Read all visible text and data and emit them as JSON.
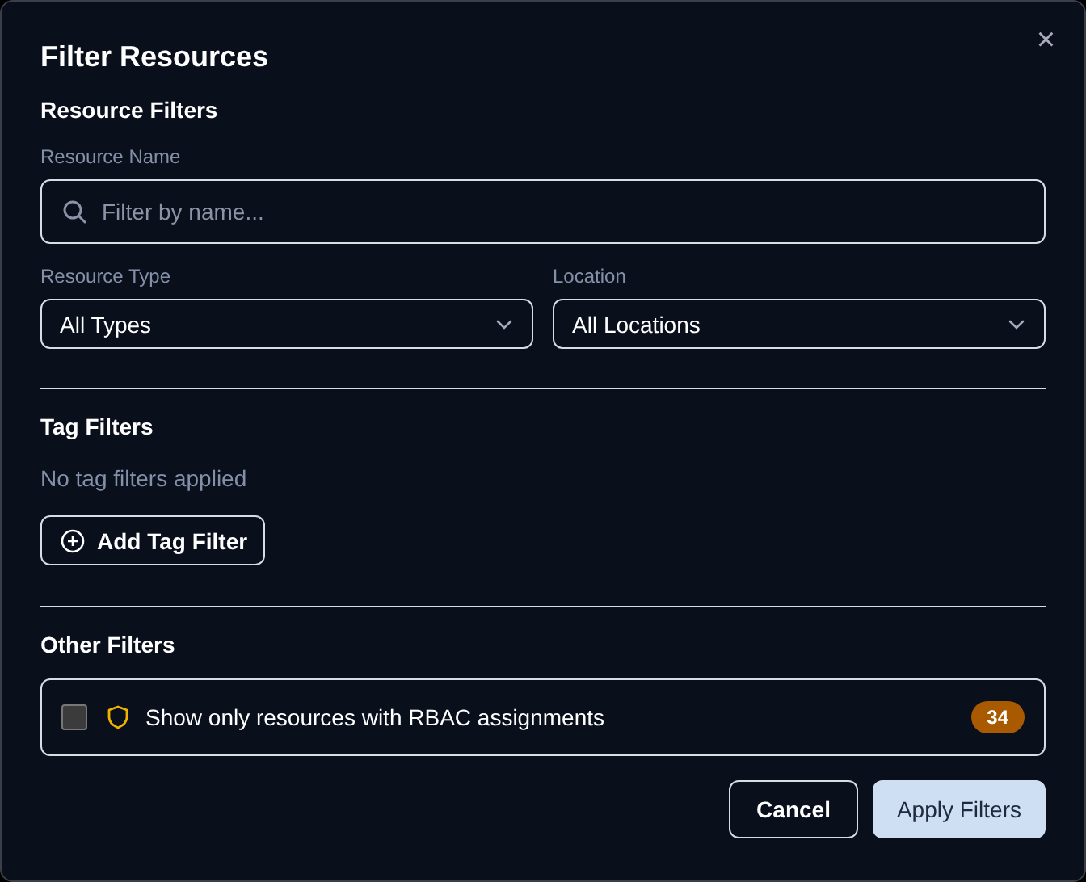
{
  "dialog": {
    "title": "Filter Resources",
    "close": "×"
  },
  "resource_filters": {
    "heading": "Resource Filters",
    "name_field": {
      "label": "Resource Name",
      "placeholder": "Filter by name..."
    },
    "selects": [
      {
        "label": "Resource Type",
        "value": "All Types"
      },
      {
        "label": "Location",
        "value": "All Locations"
      }
    ]
  },
  "tag_filters": {
    "heading": "Tag Filters",
    "empty_text": "No tag filters applied",
    "add_button": "Add Tag Filter"
  },
  "other_filters": {
    "heading": "Other Filters",
    "rbac": {
      "checked": false,
      "label": "Show only resources with RBAC assignments",
      "count": "34"
    }
  },
  "buttons": [
    {
      "kind": "secondary",
      "label": "Cancel"
    },
    {
      "kind": "primary",
      "label": "Apply Filters"
    }
  ]
}
